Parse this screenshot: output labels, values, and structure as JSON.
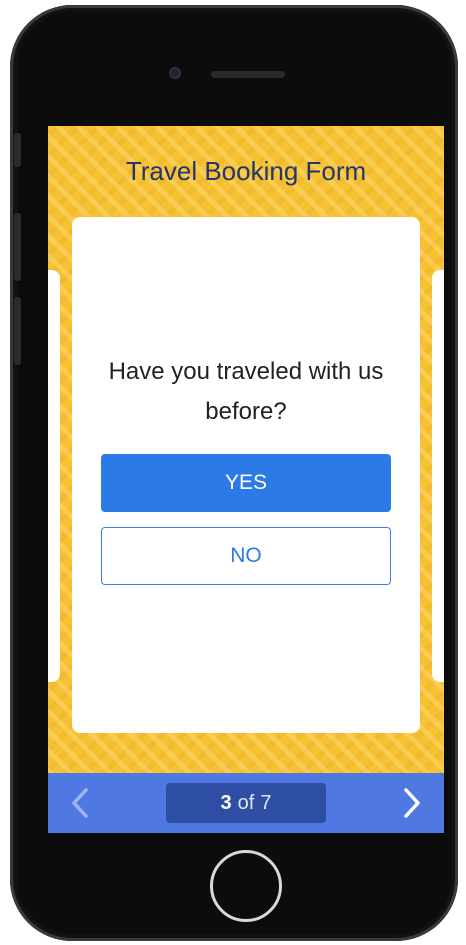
{
  "form": {
    "title": "Travel Booking Form",
    "question": "Have you traveled with us before?",
    "options": {
      "yes": "YES",
      "no": "NO"
    }
  },
  "pager": {
    "current": "3",
    "of_label": "of",
    "total": "7",
    "prev_icon": "chevron-left-icon",
    "next_icon": "chevron-right-icon"
  },
  "colors": {
    "accent": "#2b7ae6",
    "nav_bar": "#4f78e3",
    "counter_bg": "#2e4ea3",
    "background": "#f6c133",
    "title_text": "#22366e"
  }
}
